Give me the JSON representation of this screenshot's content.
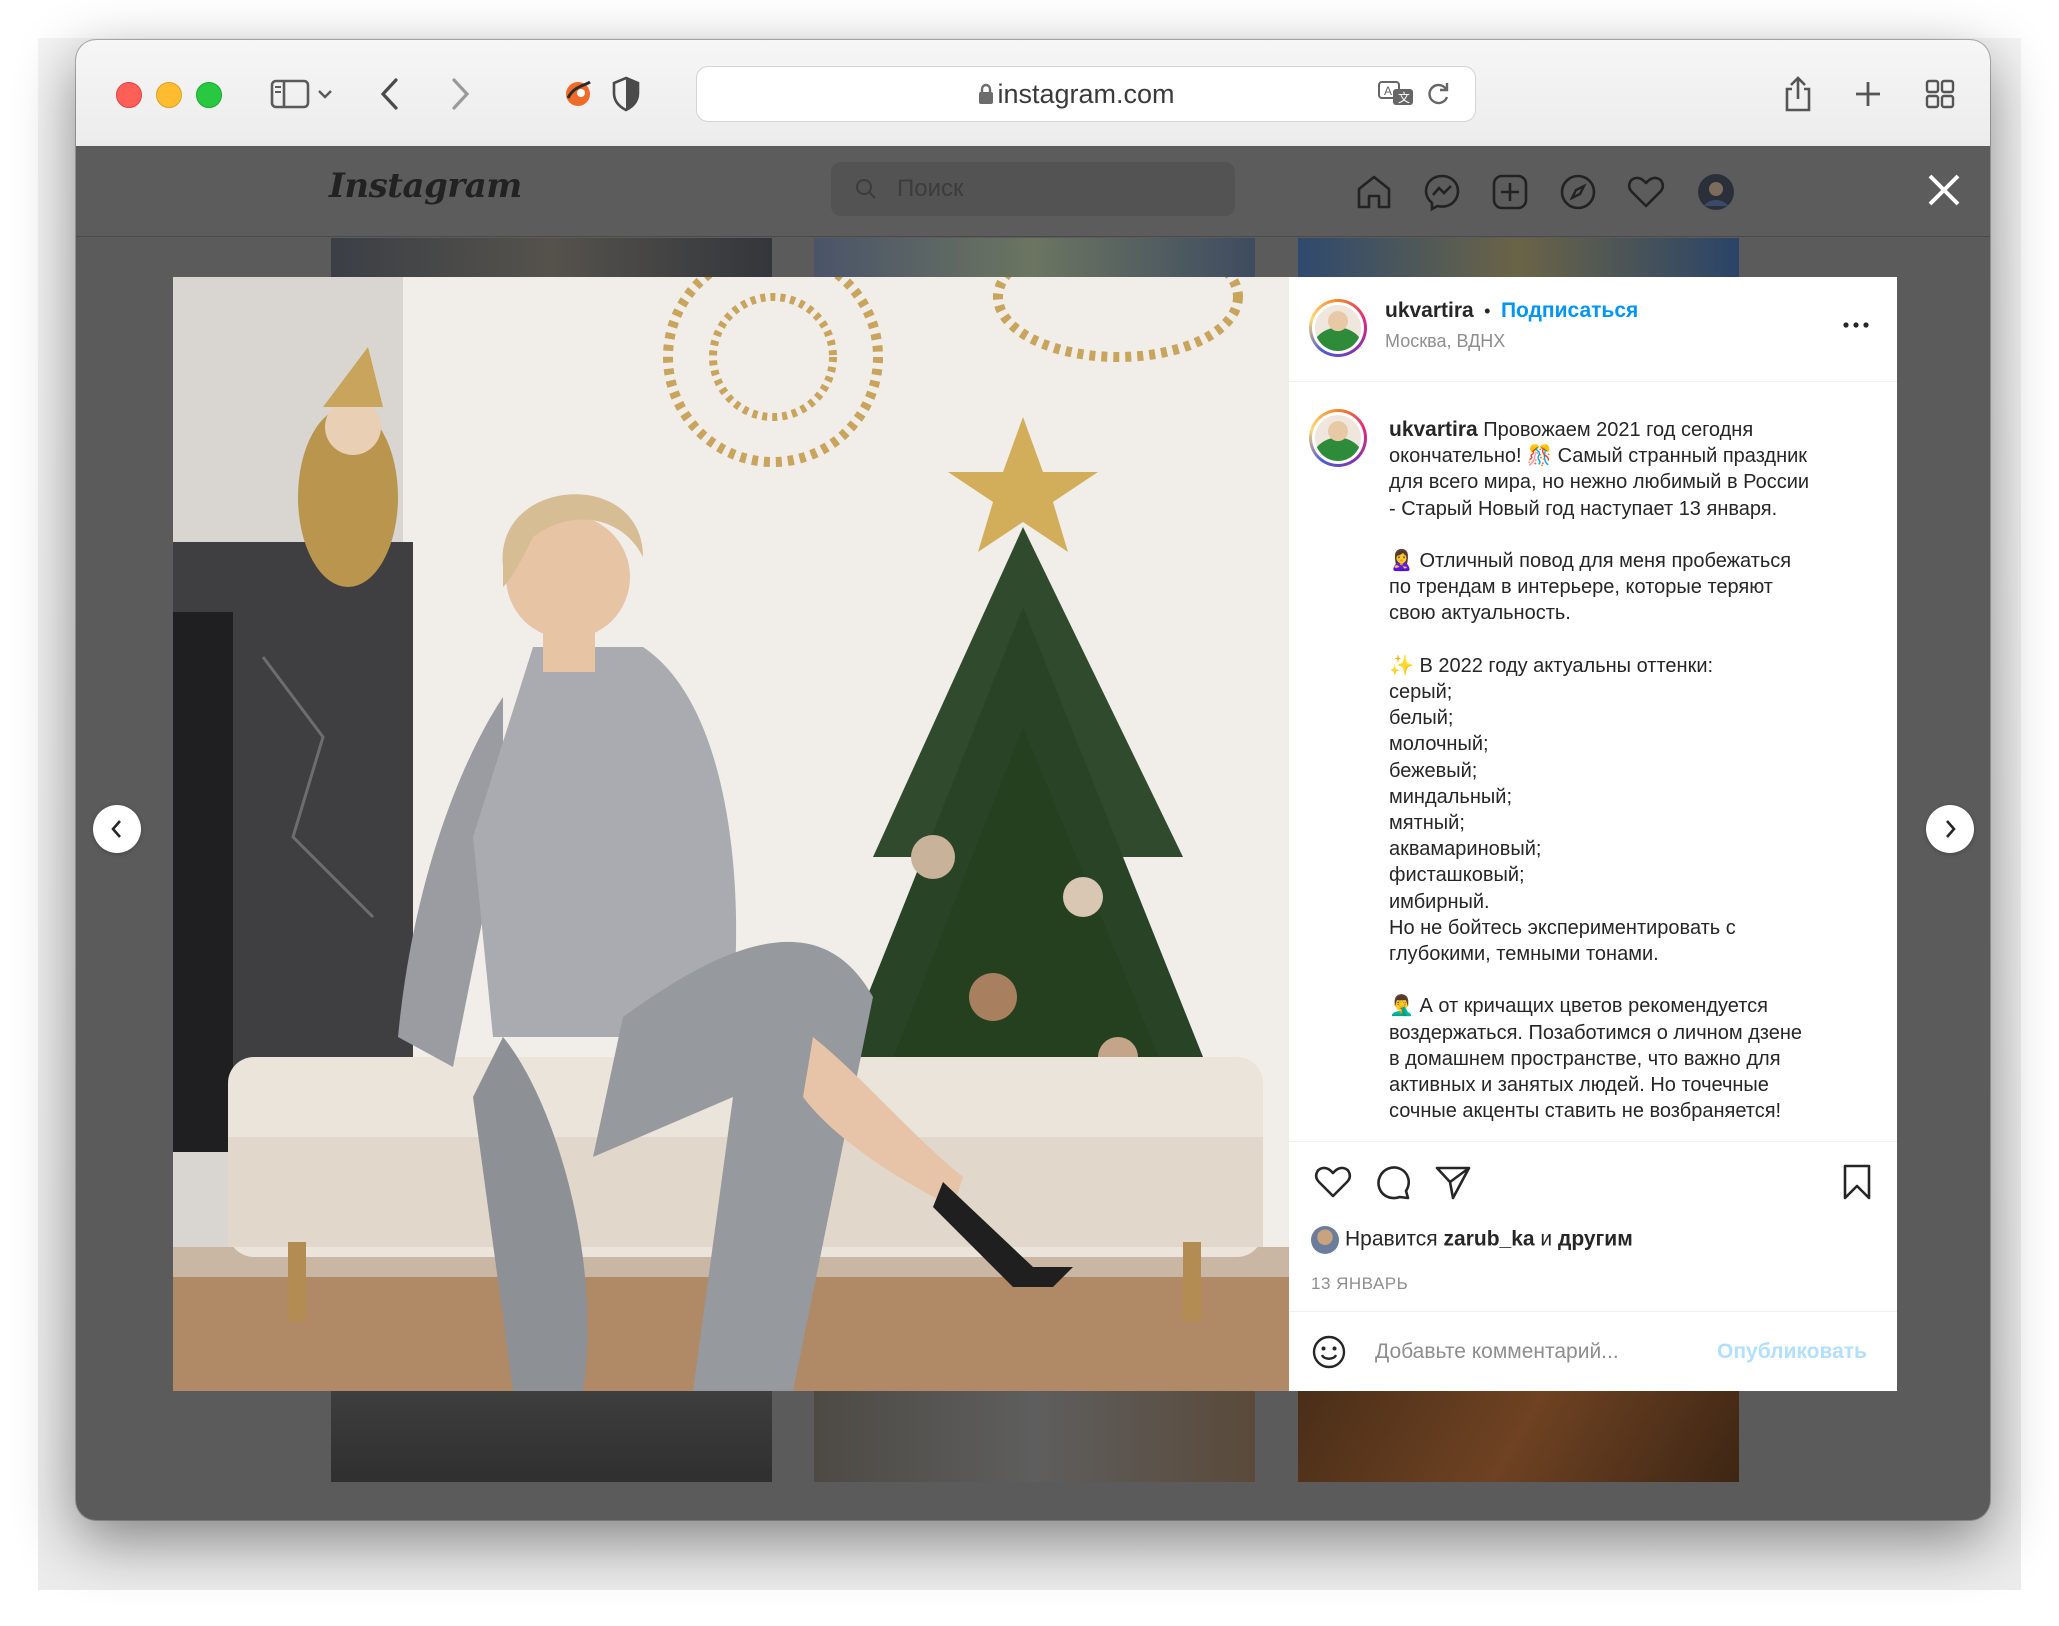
{
  "browser": {
    "url": "instagram.com"
  },
  "instagram": {
    "logo": "Instagram",
    "search_placeholder": "Поиск"
  },
  "post": {
    "username": "ukvartira",
    "separator": "•",
    "follow_label": "Подписаться",
    "location": "Москва, ВДНХ",
    "more_label": "•••",
    "caption_username": "ukvartira",
    "caption_lines": [
      "Провожаем 2021 год сегодня",
      "окончательно! 🎊 Самый странный праздник",
      "для всего мира, но нежно любимый в России",
      "- Старый Новый год наступает 13 января.",
      "",
      "🙎‍♀️ Отличный повод для меня пробежаться",
      "по трендам в интерьере, которые теряют",
      "свою актуальность.",
      "",
      "✨ В 2022 году актуальны оттенки:",
      "серый;",
      "белый;",
      "молочный;",
      "бежевый;",
      "миндальный;",
      "мятный;",
      "аквамариновый;",
      "фисташковый;",
      "имбирный.",
      "Но не бойтесь экспериментировать с",
      "глубокими, темными тонами.",
      "",
      "🤦‍♂️ А от кричащих цветов рекомендуется",
      "воздержаться. Позаботимся о личном дзене",
      "в домашнем пространстве, что важно для",
      "активных и занятых людей. Но точечные",
      "сочные акценты ставить не возбраняется!"
    ],
    "likes_prefix": "Нравится",
    "likes_user": "zarub_ka",
    "likes_conj": "и",
    "likes_others": "другим",
    "date": "13 ЯНВАРЬ",
    "comment_placeholder": "Добавьте комментарий...",
    "publish_label": "Опубликовать"
  },
  "colors": {
    "link_blue": "#0095f6",
    "publish_disabled": "#b2dffc",
    "overlay": "#5b5b5b"
  }
}
